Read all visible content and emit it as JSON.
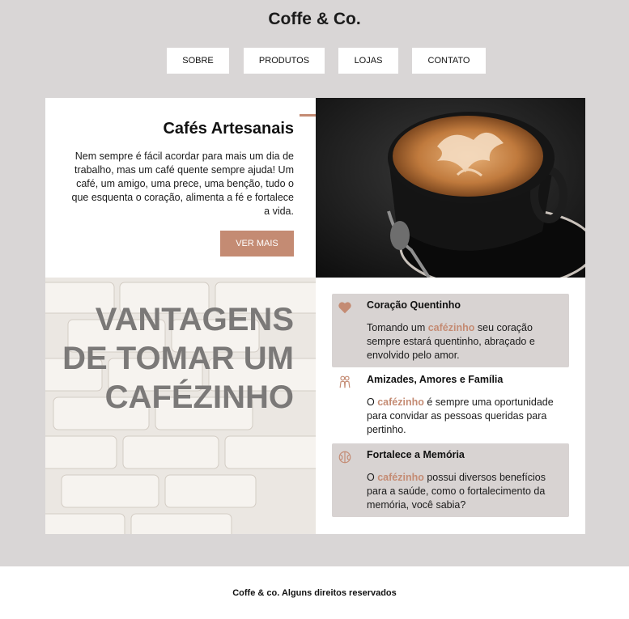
{
  "site": {
    "title": "Coffe & Co."
  },
  "nav": {
    "items": [
      "SOBRE",
      "PRODUTOS",
      "LOJAS",
      "CONTATO"
    ]
  },
  "intro": {
    "title": "Cafés Artesanais",
    "text": "Nem sempre é fácil acordar para mais um dia de trabalho, mas um café quente sempre ajuda! Um café, um amigo, uma prece, uma benção, tudo o que esquenta o coração, alimenta a fé e fortalece a vida.",
    "button": "VER MAIS"
  },
  "advantages": {
    "title": "VANTAGENS DE TOMAR UM CAFÉZINHO",
    "items": [
      {
        "title": "Coração Quentinho",
        "before": "Tomando um ",
        "highlight": "cafézinho",
        "after": " seu coração sempre estará quentinho, abraçado e envolvido pelo amor.",
        "icon": "heart-icon"
      },
      {
        "title": "Amizades, Amores e Família",
        "before": "O ",
        "highlight": "cafézinho",
        "after": " é sempre uma oportunidade para convidar as pessoas queridas para pertinho.",
        "icon": "people-icon"
      },
      {
        "title": "Fortalece a Memória",
        "before": "O ",
        "highlight": "cafézinho",
        "after": " possui diversos benefícios para a saúde, como o fortalecimento da memória, você sabia?",
        "icon": "brain-icon"
      }
    ]
  },
  "footer": {
    "text": "Coffe & co. Alguns direitos reservados"
  },
  "colors": {
    "accent": "#c48b73",
    "page_bg": "#d9d6d6",
    "card_bg": "#ffffff",
    "benefit_bg": "#d8d3d2"
  }
}
